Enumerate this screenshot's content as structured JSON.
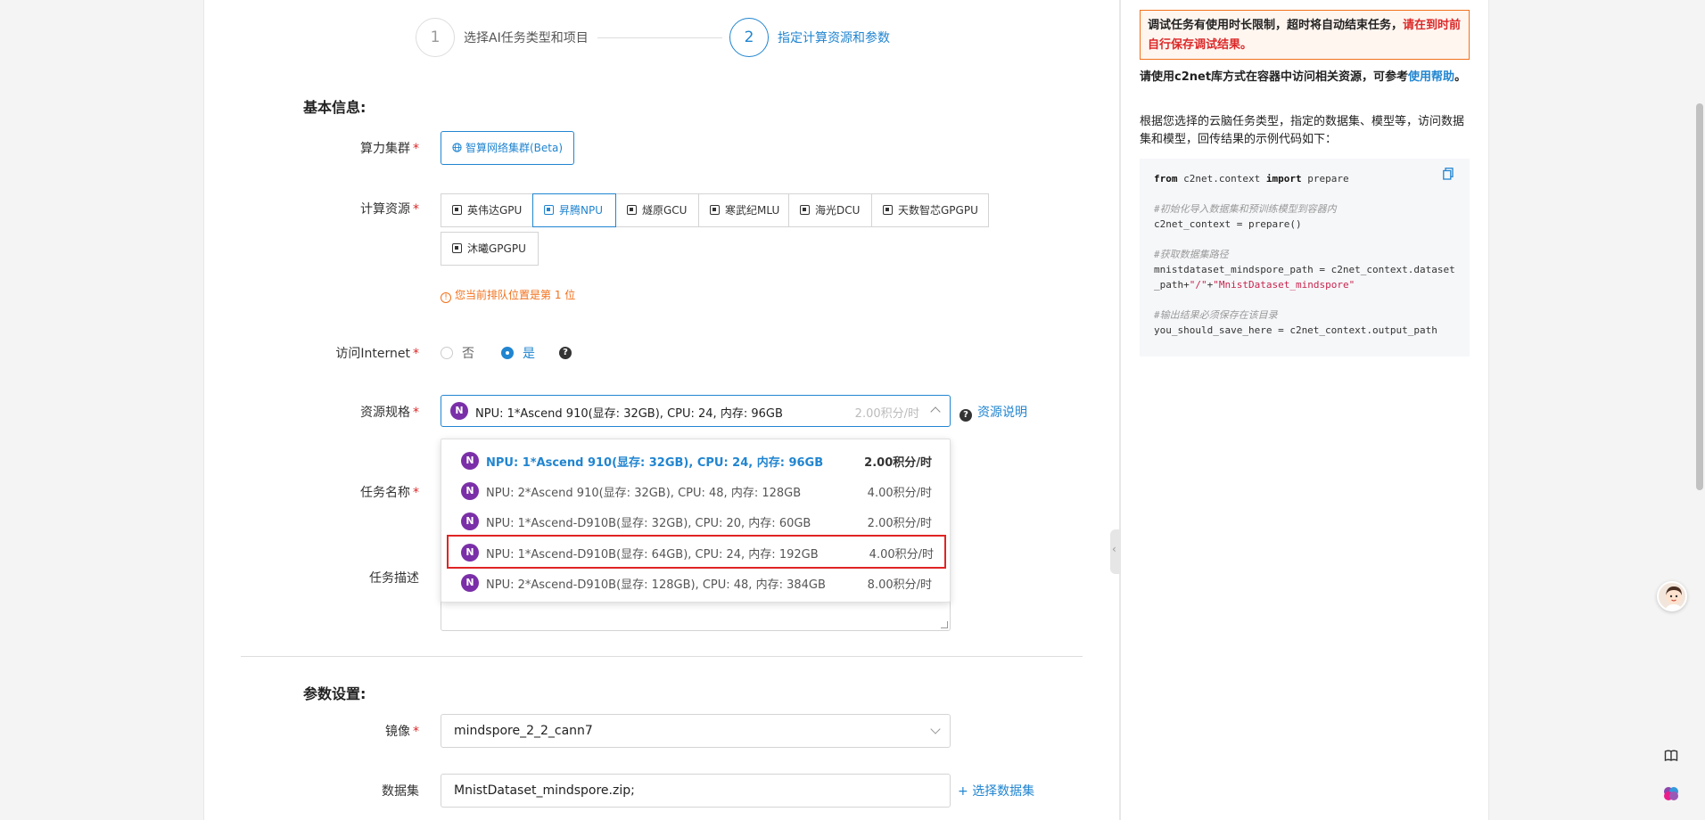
{
  "steps": [
    {
      "num": "1",
      "label": "选择AI任务类型和项目"
    },
    {
      "num": "2",
      "label": "指定计算资源和参数"
    }
  ],
  "basic_info": {
    "title": "基本信息:",
    "cluster_label": "算力集群",
    "cluster_value": "智算网络集群(Beta)",
    "compute_label": "计算资源",
    "compute_options": [
      "英伟达GPU",
      "昇腾NPU",
      "燧原GCU",
      "寒武纪MLU",
      "海光DCU",
      "天数智芯GPGPU",
      "沐曦GPGPU"
    ],
    "compute_selected": "昇腾NPU",
    "queue_tip": "您当前排队位置是第 1 位",
    "internet_label": "访问Internet",
    "internet_no": "否",
    "internet_yes": "是",
    "spec_label": "资源规格",
    "spec_value": "NPU: 1*Ascend 910(显存: 32GB), CPU: 24, 内存: 96GB",
    "spec_price": "2.00积分/时",
    "res_help": "资源说明",
    "task_name_label": "任务名称",
    "task_desc_label": "任务描述"
  },
  "spec_options": [
    {
      "badge": "N",
      "text": "NPU: 1*Ascend 910(显存: 32GB), CPU: 24, 内存: 96GB",
      "price": "2.00积分/时"
    },
    {
      "badge": "N",
      "text": "NPU: 2*Ascend 910(显存: 32GB), CPU: 48, 内存: 128GB",
      "price": "4.00积分/时"
    },
    {
      "badge": "N",
      "text": "NPU: 1*Ascend-D910B(显存: 32GB), CPU: 20, 内存: 60GB",
      "price": "2.00积分/时"
    },
    {
      "badge": "N",
      "text": "NPU: 1*Ascend-D910B(显存: 64GB), CPU: 24, 内存: 192GB",
      "price": "4.00积分/时"
    },
    {
      "badge": "N",
      "text": "NPU: 2*Ascend-D910B(显存: 128GB), CPU: 48, 内存: 384GB",
      "price": "8.00积分/时"
    }
  ],
  "params": {
    "title": "参数设置:",
    "image_label": "镜像",
    "image_value": "mindspore_2_2_cann7",
    "dataset_label": "数据集",
    "dataset_value": "MnistDataset_mindspore.zip;",
    "dataset_add": "选择数据集"
  },
  "side": {
    "warn_part1": "调试任务有使用时长限制，超时将自动结束任务，",
    "warn_part2": "请在到时前自行保存调试结果。",
    "access_text": "请使用c2net库方式在容器中访问相关资源，可参考",
    "access_link": "使用帮助",
    "access_end": "。",
    "desc_text": "根据您选择的云脑任务类型，指定的数据集、模型等，访问数据集和模型，回传结果的示例代码如下：",
    "code": {
      "l1_kw1": "from",
      "l1_mid": " c2net.context ",
      "l1_kw2": "import",
      "l1_end": " prepare",
      "c1": "#初始化导入数据集和预训练模型到容器内",
      "l2": "c2net_context = prepare()",
      "c2": "#获取数据集路径",
      "l3": "mnistdataset_mindspore_path = c2net_context.dataset",
      "l4a": "_path+",
      "l4b": "\"/\"",
      "l4c": "+",
      "l4d": "\"MnistDataset_mindspore\"",
      "c3": "#输出结果必须保存在该目录",
      "l5": "you_should_save_here = c2net_context.output_path"
    }
  },
  "colors": {
    "primary": "#2185d0",
    "danger": "#db2828",
    "warning": "#f2711c",
    "npu_badge": "#7a2fa8"
  }
}
